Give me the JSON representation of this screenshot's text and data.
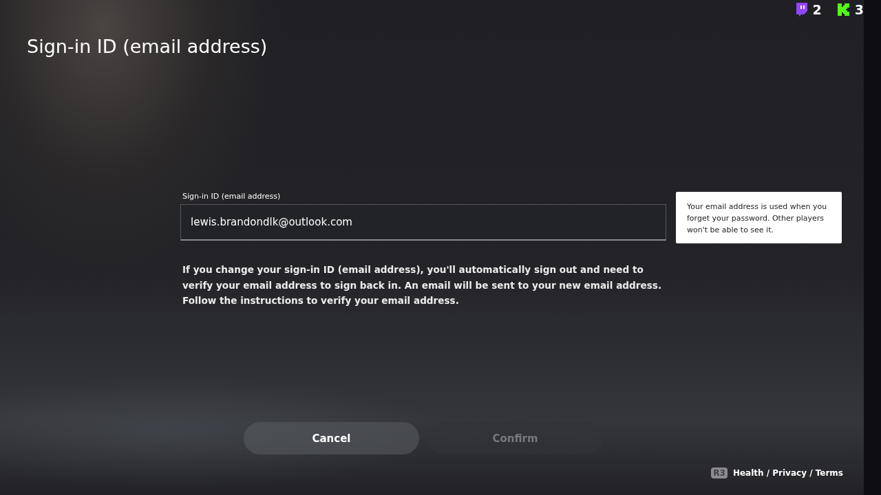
{
  "badges": [
    {
      "kind": "chat",
      "count": "2"
    },
    {
      "kind": "k",
      "count": "3"
    }
  ],
  "title": "Sign-in ID (email address)",
  "field": {
    "label": "Sign-in ID (email address)",
    "value": "lewis.brandondlk@outlook.com"
  },
  "tooltip": "Your email address is used when you forget your password. Other players won't be able to see it.",
  "description": "If you change your sign-in ID (email address), you'll automatically sign out and need to verify your email address to sign back in. An email will be sent to your new email address. Follow the instructions to verify your email address.",
  "buttons": [
    {
      "label": "Cancel",
      "disabled": false
    },
    {
      "label": "Confirm",
      "disabled": true
    }
  ],
  "footer": {
    "key": "R3",
    "links": "Health / Privacy / Terms"
  }
}
